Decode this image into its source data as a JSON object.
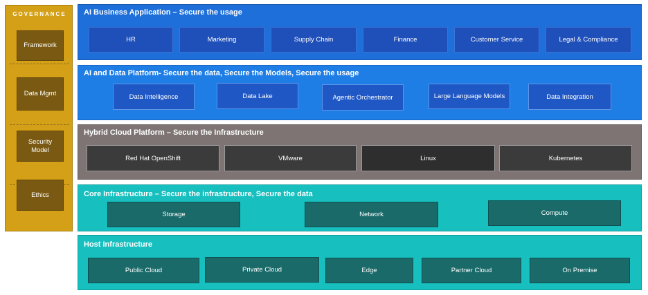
{
  "governance": {
    "title": "GOVERNANCE",
    "items": [
      "Framework",
      "Data Mgmt",
      "Security Model",
      "Ethics"
    ]
  },
  "layers": [
    {
      "title": "AI Business Application – Secure the usage",
      "items": [
        "HR",
        "Marketing",
        "Supply Chain",
        "Finance",
        "Customer Service",
        "Legal & Compliance"
      ]
    },
    {
      "title": "AI and Data Platform- Secure the data, Secure the Models, Secure the usage",
      "items": [
        "Data Intelligence",
        "Data Lake",
        "Agentic Orchestrator",
        "Large Language Models",
        "Data Integration"
      ]
    },
    {
      "title": "Hybrid Cloud Platform – Secure the Infrastructure",
      "items": [
        "Red Hat OpenShift",
        "VMware",
        "Linux",
        "Kubernetes"
      ]
    },
    {
      "title": "Core Infrastructure – Secure the infrastructure, Secure the data",
      "items": [
        "Storage",
        "Network",
        "Compute"
      ]
    },
    {
      "title": "Host Infrastructure",
      "items": [
        "Public Cloud",
        "Private Cloud",
        "Edge",
        "Partner Cloud",
        "On Premise"
      ]
    }
  ],
  "colors": {
    "governance": "#d4a017",
    "business_app": "#1e6fd9",
    "ai_data_platform": "#1e7ee6",
    "hybrid_cloud": "#7d7473",
    "core_infra": "#17bfbf",
    "host_infra": "#17bfbf"
  }
}
